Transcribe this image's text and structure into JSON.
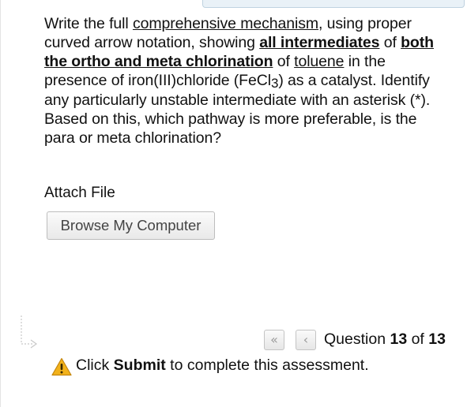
{
  "question": {
    "p1": "Write the full ",
    "link1": "comprehensive mechanism",
    "p2": ", using proper curved arrow notation, showing ",
    "bold1": "all intermediates",
    "p3": " of ",
    "bold2": "both the ortho and meta chlorination",
    "p4": " of ",
    "link2": "toluene",
    "p5": " in the presence of iron(III)chloride (FeCl",
    "sub": "3",
    "p6": ") as a catalyst. Identify any particularly unstable intermediate with an asterisk (*). Based on this, which pathway is more preferable, is the para or meta chlorination?"
  },
  "attach": {
    "label": "Attach File",
    "browse_button": "Browse My Computer"
  },
  "navigation": {
    "first_icon": "double-chevron-left-icon",
    "prev_icon": "chevron-left-icon",
    "first_glyph": "«",
    "prev_glyph": "‹",
    "counter_prefix": "Question ",
    "current": "13",
    "counter_mid": " of ",
    "total": "13"
  },
  "footer": {
    "warning_icon": "warning-triangle-icon",
    "prefix": "Click ",
    "submit_word": "Submit",
    "suffix": " to complete this assessment.",
    "warning_color": "#f2b21b"
  }
}
